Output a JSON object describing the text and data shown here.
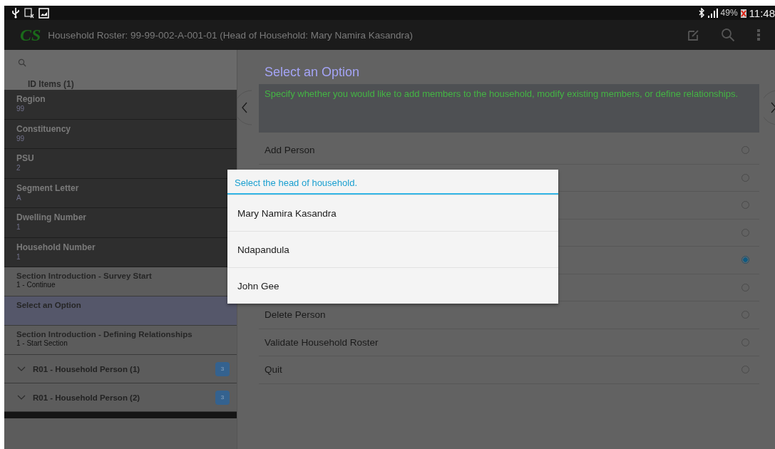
{
  "status_bar": {
    "battery": "49%",
    "time": "11:48"
  },
  "action_bar": {
    "logo_text": "CS",
    "title": "Household Roster: 99-99-002-A-001-01 (Head of Household: Mary Namira Kasandra)"
  },
  "sidebar": {
    "header": "ID Items (1)",
    "items": [
      {
        "kind": "id",
        "label": "Region",
        "value": "99"
      },
      {
        "kind": "id",
        "label": "Constituency",
        "value": "99"
      },
      {
        "kind": "id",
        "label": "PSU",
        "value": "2"
      },
      {
        "kind": "id",
        "label": "Segment Letter",
        "value": "A"
      },
      {
        "kind": "id",
        "label": "Dwelling Number",
        "value": "1"
      },
      {
        "kind": "id",
        "label": "Household Number",
        "value": "1"
      },
      {
        "kind": "field",
        "label": "Section Introduction - Survey Start",
        "value": "1 - Continue",
        "selected": false
      },
      {
        "kind": "field",
        "label": "Select an Option",
        "selected": true
      },
      {
        "kind": "field",
        "label": "Section Introduction - Defining Relationships",
        "value": "1 - Start Section",
        "selected": false
      },
      {
        "kind": "group",
        "label": "R01 - Household Person (1)",
        "badge": "3"
      },
      {
        "kind": "group",
        "label": "R01 - Household Person (2)",
        "badge": "3"
      }
    ]
  },
  "question": {
    "title": "Select an Option",
    "instruction": "Specify whether you would like to add members to the household, modify existing members, or define relationships.",
    "options": [
      {
        "label": "Add Person",
        "selected": false
      },
      {
        "selected": false
      },
      {
        "selected": false
      },
      {
        "selected": false
      },
      {
        "selected": true
      },
      {
        "selected": false
      },
      {
        "label": "Delete Person",
        "selected": false
      },
      {
        "label": "Validate Household Roster",
        "selected": false
      },
      {
        "label": "Quit",
        "selected": false
      }
    ]
  },
  "dialog": {
    "title": "Select the head of household.",
    "items": [
      "Mary Namira Kasandra",
      "Ndapandula",
      "John Gee"
    ]
  }
}
